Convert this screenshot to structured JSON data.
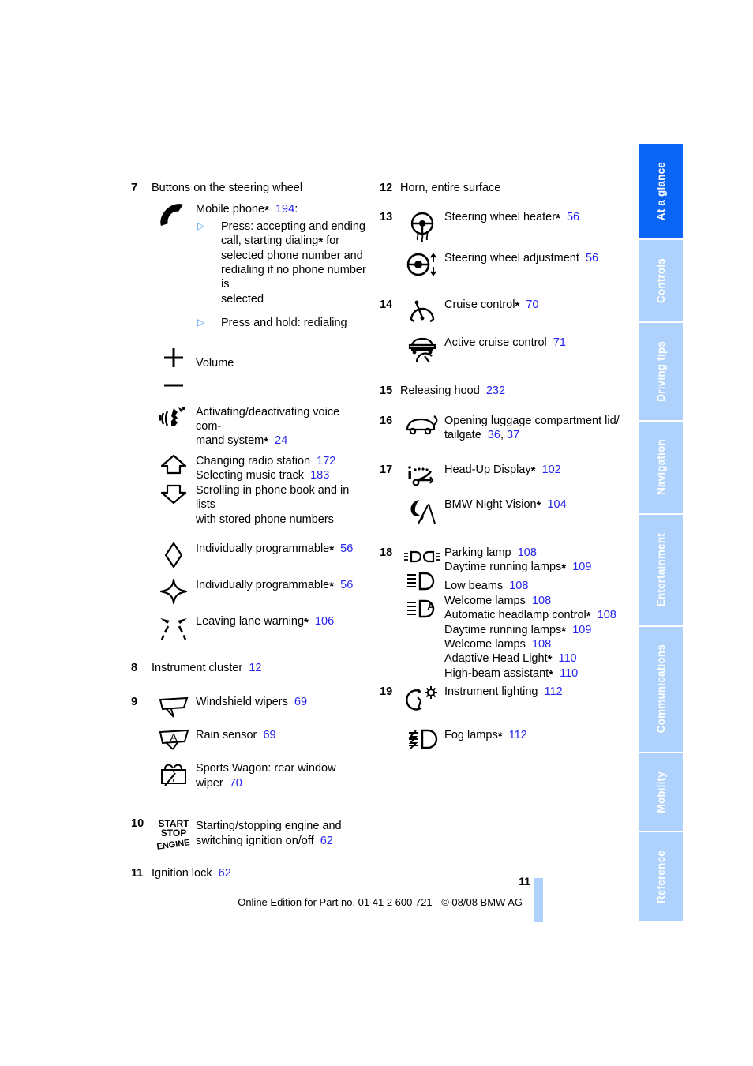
{
  "document": {
    "page_number": "11",
    "footer_text": "Online Edition for Part no. 01 41 2 600 721 - © 08/08 BMW AG"
  },
  "colors": {
    "reference_blue": "#2424ee",
    "tab_active": "#0a64f5",
    "tab_inactive": "#aed2fb",
    "bullet_blue": "#4d9bf5"
  },
  "tabs": [
    {
      "label": "At a glance",
      "active": true
    },
    {
      "label": "Controls",
      "active": false
    },
    {
      "label": "Driving tips",
      "active": false
    },
    {
      "label": "Navigation",
      "active": false
    },
    {
      "label": "Entertainment",
      "active": false
    },
    {
      "label": "Communications",
      "active": false
    },
    {
      "label": "Mobility",
      "active": false
    },
    {
      "label": "Reference",
      "active": false
    }
  ],
  "left_column": {
    "item7": {
      "number": "7",
      "title": "Buttons on the steering wheel",
      "phone_label": "Mobile phone",
      "phone_star": "*",
      "phone_ref": "194",
      "phone_colon": ":",
      "bullet1_a": "Press: accepting and ending",
      "bullet1_b": "call, starting dialing",
      "bullet1_b_star": "*",
      "bullet1_b_tail": " for",
      "bullet1_c": "selected phone number and",
      "bullet1_d": "redialing if no phone number is",
      "bullet1_e": "selected",
      "bullet2": "Press and hold: redialing",
      "volume_label": "Volume",
      "voice_line1": "Activating/deactivating voice com-",
      "voice_line2": "mand system",
      "voice_star": "*",
      "voice_ref": "24",
      "radio_label": "Changing radio station",
      "radio_ref": "172",
      "music_label": "Selecting music track",
      "music_ref": "183",
      "scroll_line1": "Scrolling in phone book and in lists",
      "scroll_line2": "with stored phone numbers",
      "prog1_label": "Individually programmable",
      "prog1_star": "*",
      "prog1_ref": "56",
      "prog2_label": "Individually programmable",
      "prog2_star": "*",
      "prog2_ref": "56",
      "lane_label": "Leaving lane warning",
      "lane_star": "*",
      "lane_ref": "106"
    },
    "item8": {
      "number": "8",
      "label": "Instrument cluster",
      "ref": "12"
    },
    "item9": {
      "number": "9",
      "wipers_label": "Windshield wipers",
      "wipers_ref": "69",
      "rain_label": "Rain sensor",
      "rain_ref": "69",
      "wagon_line1": "Sports Wagon: rear window",
      "wagon_line2": "wiper",
      "wagon_ref": "70"
    },
    "item10": {
      "number": "10",
      "icon_line1": "START",
      "icon_line2": "STOP",
      "icon_line3": "ENGINE",
      "text_line1": "Starting/stopping engine and",
      "text_line2": "switching ignition on/off",
      "ref": "62"
    },
    "item11": {
      "number": "11",
      "label": "Ignition lock",
      "ref": "62"
    }
  },
  "right_column": {
    "item12": {
      "number": "12",
      "label": "Horn, entire surface"
    },
    "item13": {
      "number": "13",
      "heater_label": "Steering wheel heater",
      "heater_star": "*",
      "heater_ref": "56",
      "adjust_label": "Steering wheel adjustment",
      "adjust_ref": "56"
    },
    "item14": {
      "number": "14",
      "cruise_label": "Cruise control",
      "cruise_star": "*",
      "cruise_ref": "70",
      "active_label": "Active cruise control",
      "active_ref": "71"
    },
    "item15": {
      "number": "15",
      "label": "Releasing hood",
      "ref": "232"
    },
    "item16": {
      "number": "16",
      "line1": "Opening luggage compartment lid/",
      "line2": "tailgate",
      "ref1": "36",
      "ref_sep": ",",
      "ref2": "37"
    },
    "item17": {
      "number": "17",
      "hud_label": "Head-Up Display",
      "hud_star": "*",
      "hud_ref": "102",
      "night_label": "BMW Night Vision",
      "night_star": "*",
      "night_ref": "104"
    },
    "item18": {
      "number": "18",
      "parking_label": "Parking lamp",
      "parking_ref": "108",
      "drl1_label": "Daytime running lamps",
      "drl1_star": "*",
      "drl1_ref": "109",
      "low_label": "Low beams",
      "low_ref": "108",
      "welcome1_label": "Welcome lamps",
      "welcome1_ref": "108",
      "auto_label": "Automatic headlamp control",
      "auto_star": "*",
      "auto_ref": "108",
      "drl2_label": "Daytime running lamps",
      "drl2_star": "*",
      "drl2_ref": "109",
      "welcome2_label": "Welcome lamps",
      "welcome2_ref": "108",
      "adaptive_label": "Adaptive Head Light",
      "adaptive_star": "*",
      "adaptive_ref": "110",
      "highbeam_label": "High-beam assistant",
      "highbeam_star": "*",
      "highbeam_ref": "110"
    },
    "item19": {
      "number": "19",
      "instrument_label": "Instrument lighting",
      "instrument_ref": "112",
      "fog_label": "Fog lamps",
      "fog_star": "*",
      "fog_ref": "112"
    }
  },
  "icons": {
    "phone": "phone-handset-icon",
    "plus": "volume-up-icon",
    "minus": "volume-down-icon",
    "voice": "voice-command-icon",
    "arrow_up": "arrow-up-icon",
    "arrow_down": "arrow-down-icon",
    "diamond": "diamond-icon",
    "star4": "four-point-star-icon",
    "lane": "leaving-lane-warning-icon",
    "wiper": "windshield-wiper-icon",
    "rain": "rain-sensor-icon",
    "rear_wiper": "rear-window-wiper-icon",
    "start_stop": "start-stop-engine-icon",
    "wheel_heater": "steering-wheel-heater-icon",
    "wheel_adjust": "steering-wheel-adjustment-icon",
    "cruise": "cruise-control-icon",
    "active_cruise": "active-cruise-control-icon",
    "trunk": "luggage-compartment-icon",
    "hud": "head-up-display-icon",
    "night_vision": "night-vision-icon",
    "parking_lamp": "parking-lamp-icon",
    "low_beam": "low-beam-icon",
    "auto_headlamp": "automatic-headlamp-icon",
    "instrument_light": "instrument-lighting-icon",
    "fog_lamp": "fog-lamp-icon"
  }
}
